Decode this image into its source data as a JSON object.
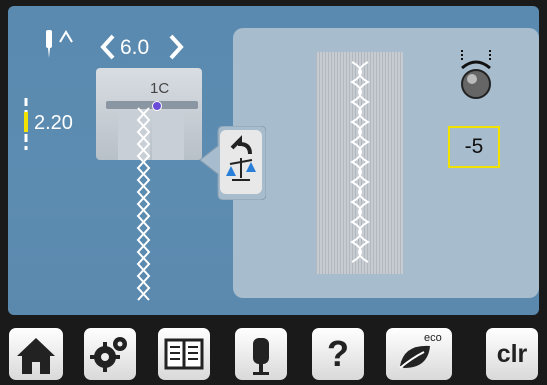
{
  "stitch": {
    "length_label": "6.0",
    "needle_position": "2.20",
    "presser_foot": "1C"
  },
  "balance": {
    "value": "-5"
  },
  "icons": {
    "needle_up": "needle-up-icon",
    "balance": "balance-scale-icon",
    "knob": "balance-knob-icon"
  },
  "toolbar": {
    "home": "home-icon",
    "setup": "gears-icon",
    "tutorial": "book-icon",
    "advisor": "mannequin-icon",
    "help_label": "?",
    "eco": "eco-leaf-icon",
    "eco_label": "eco",
    "clear_label": "clr"
  },
  "colors": {
    "screen_bg": "#5b89ae",
    "panel_bg": "#a7bccc",
    "highlight": "#f2e200",
    "toolbar_bg": "#1a1a1a"
  }
}
